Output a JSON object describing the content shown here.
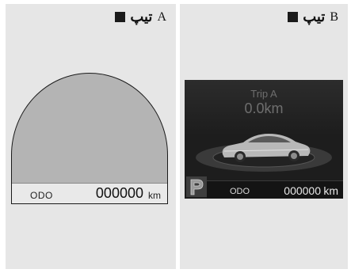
{
  "panel_a": {
    "type_word": "تیپ",
    "type_letter": "A",
    "odo_label": "ODO",
    "odo_value": "000000",
    "odo_unit": "km"
  },
  "panel_b": {
    "type_word": "تیپ",
    "type_letter": "B",
    "trip_label": "Trip A",
    "trip_value": "0.0km",
    "odo_label": "ODO",
    "odo_value": "000000",
    "odo_unit": "km"
  },
  "icons": {
    "square": "square-bullet-icon",
    "parking": "parking-icon",
    "car": "car-icon"
  },
  "colors": {
    "panel_bg": "#e6e6e6",
    "dome_fill": "#b4b4b4",
    "screen_bg": "#1d1d1d"
  }
}
